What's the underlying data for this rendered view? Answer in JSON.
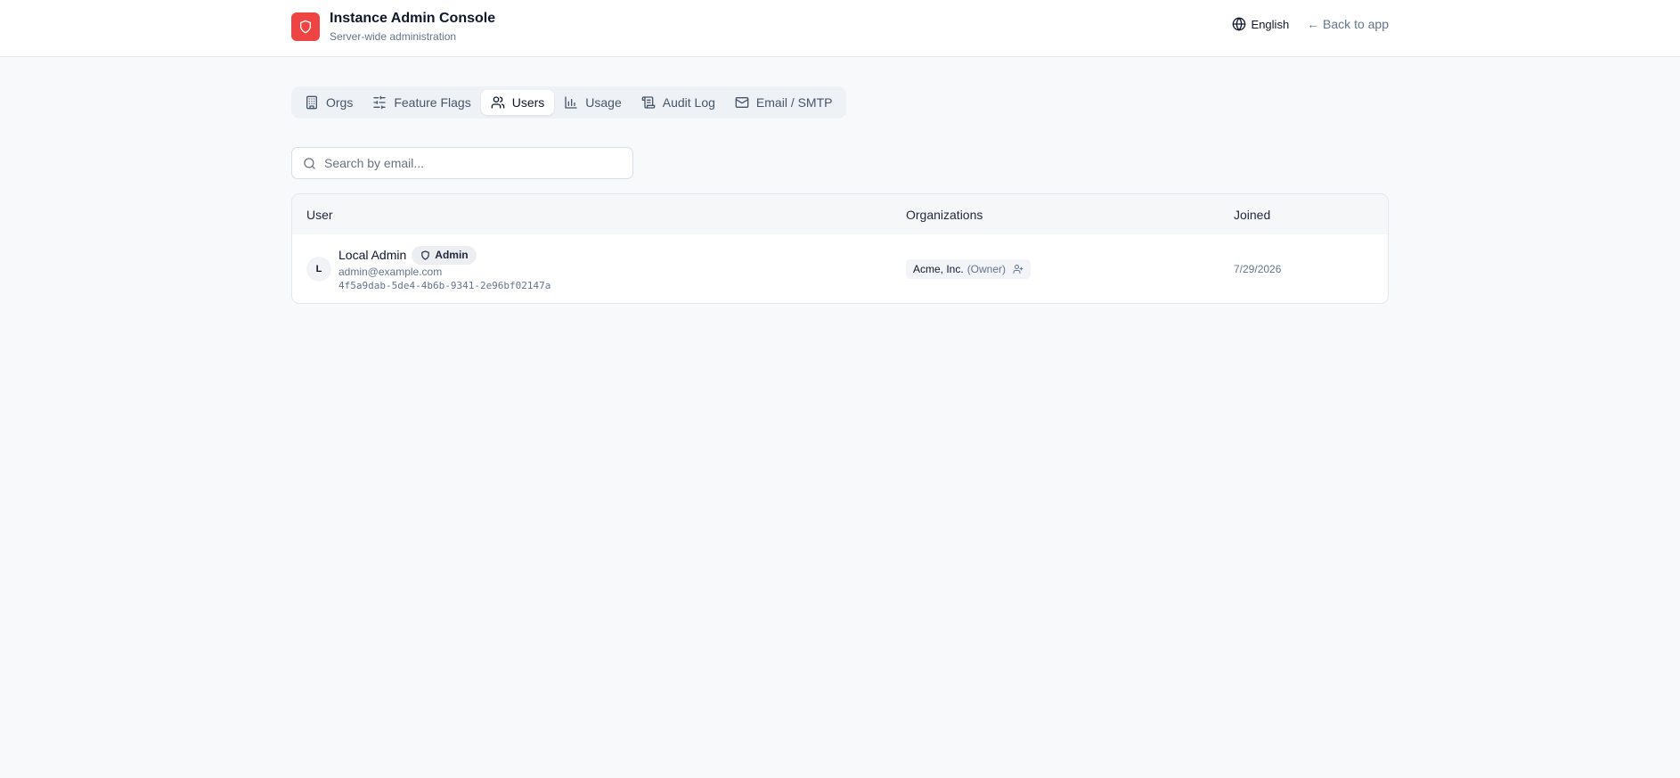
{
  "header": {
    "title": "Instance Admin Console",
    "subtitle": "Server-wide administration",
    "logo_icon": "shield-icon",
    "brand_color": "#ef4444",
    "language": "English",
    "back_link": "← Back to app"
  },
  "tabs": [
    {
      "label": "Orgs",
      "icon": "building-icon",
      "active": false
    },
    {
      "label": "Feature Flags",
      "icon": "sliders-icon",
      "active": false
    },
    {
      "label": "Users",
      "icon": "users-icon",
      "active": true
    },
    {
      "label": "Usage",
      "icon": "bar-chart-icon",
      "active": false
    },
    {
      "label": "Audit Log",
      "icon": "scroll-icon",
      "active": false
    },
    {
      "label": "Email / SMTP",
      "icon": "mail-icon",
      "active": false
    }
  ],
  "search": {
    "placeholder": "Search by email...",
    "value": ""
  },
  "table": {
    "columns": [
      "User",
      "Organizations",
      "Joined"
    ],
    "rows": [
      {
        "avatar": "L",
        "name": "Local Admin",
        "badge": "Admin",
        "email": "admin@example.com",
        "id": "4f5a9dab-5de4-4b6b-9341-2e96bf02147a",
        "org": {
          "name": "Acme, Inc.",
          "role": "(Owner)"
        },
        "joined": "7/29/2026"
      }
    ]
  }
}
